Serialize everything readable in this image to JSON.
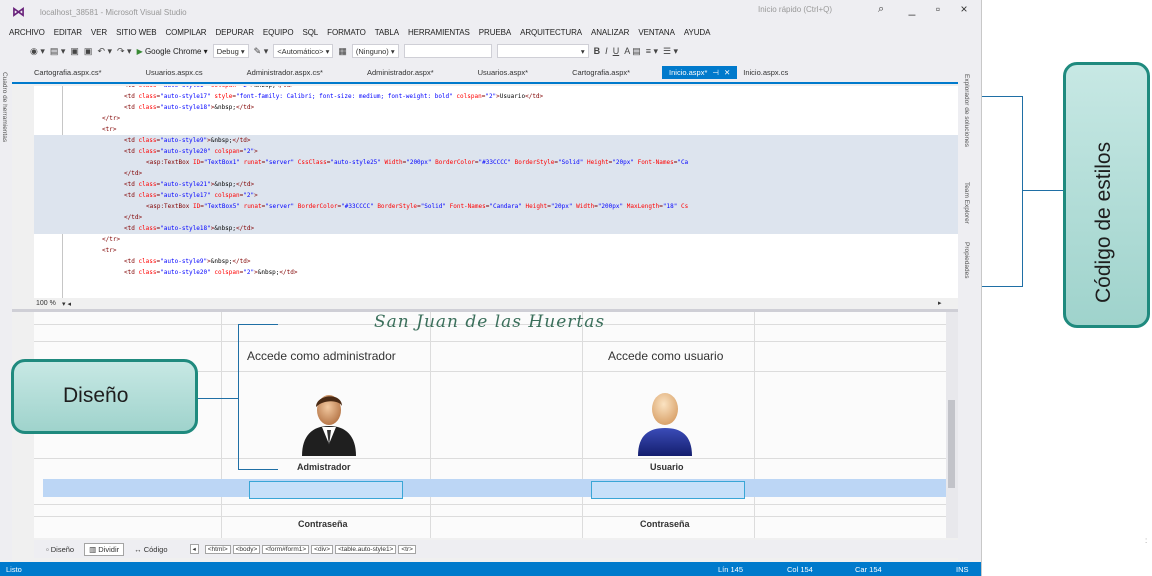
{
  "window": {
    "title": "localhost_38581 - Microsoft Visual Studio",
    "quick_launch_placeholder": "Inicio rápido (Ctrl+Q)",
    "logo_icon": "visual-studio-logo",
    "controls": [
      "_",
      "▫",
      "×"
    ]
  },
  "menu": [
    "ARCHIVO",
    "EDITAR",
    "VER",
    "SITIO WEB",
    "COMPILAR",
    "DEPURAR",
    "EQUIPO",
    "SQL",
    "FORMATO",
    "TABLA",
    "HERRAMIENTAS",
    "PRUEBA",
    "ARQUITECTURA",
    "ANALIZAR",
    "VENTANA",
    "AYUDA"
  ],
  "toolbar": {
    "run_target": "Google Chrome",
    "configuration": "Debug",
    "font_size": "<Automático>",
    "style_combo": "(Ninguno)",
    "format_buttons": [
      "B",
      "I",
      "U"
    ]
  },
  "left_panel_label": "Cuadro de herramientas",
  "doc_tabs": [
    "Cartografia.aspx.cs*",
    "Usuarios.aspx.cs",
    "Administrador.aspx.cs*",
    "Administrador.aspx*",
    "Usuarios.aspx*",
    "Cartografia.aspx*"
  ],
  "active_tab": "Inicio.aspx*",
  "after_tab": "Inicio.aspx.cs",
  "code_lines": [
    {
      "indent": 4,
      "hl": false,
      "parts": [
        [
          "t",
          "<td "
        ],
        [
          "a",
          "class"
        ],
        [
          "t",
          "="
        ],
        [
          "v",
          "\"auto-style1\""
        ],
        [
          "t",
          " "
        ],
        [
          "a",
          "colspan"
        ],
        [
          "t",
          "="
        ],
        [
          "v",
          "\"2\""
        ],
        [
          "t",
          ">"
        ],
        [
          "x",
          "&nbsp;"
        ],
        [
          "t",
          "</td>"
        ]
      ]
    },
    {
      "indent": 4,
      "hl": false,
      "parts": [
        [
          "t",
          "<td "
        ],
        [
          "a",
          "class"
        ],
        [
          "t",
          "="
        ],
        [
          "v",
          "\"auto-style17\""
        ],
        [
          "t",
          " "
        ],
        [
          "a",
          "style"
        ],
        [
          "t",
          "="
        ],
        [
          "v",
          "\"font-family: Calibri; font-size: medium; font-weight: bold\""
        ],
        [
          "t",
          " "
        ],
        [
          "a",
          "colspan"
        ],
        [
          "t",
          "="
        ],
        [
          "v",
          "\"2\""
        ],
        [
          "t",
          ">"
        ],
        [
          "x",
          "Usuario"
        ],
        [
          "t",
          "</td>"
        ]
      ]
    },
    {
      "indent": 4,
      "hl": false,
      "parts": [
        [
          "t",
          "<td "
        ],
        [
          "a",
          "class"
        ],
        [
          "t",
          "="
        ],
        [
          "v",
          "\"auto-style18\""
        ],
        [
          "t",
          ">"
        ],
        [
          "x",
          "&nbsp;"
        ],
        [
          "t",
          "</td>"
        ]
      ]
    },
    {
      "indent": 2,
      "hl": false,
      "parts": [
        [
          "t",
          "</tr>"
        ]
      ]
    },
    {
      "indent": 2,
      "hl": false,
      "parts": [
        [
          "t",
          "<tr>"
        ]
      ]
    },
    {
      "indent": 4,
      "hl": true,
      "parts": [
        [
          "t",
          "<td "
        ],
        [
          "a",
          "class"
        ],
        [
          "t",
          "="
        ],
        [
          "v",
          "\"auto-style9\""
        ],
        [
          "t",
          ">"
        ],
        [
          "x",
          "&nbsp;"
        ],
        [
          "t",
          "</td>"
        ]
      ]
    },
    {
      "indent": 4,
      "hl": true,
      "parts": [
        [
          "t",
          "<td "
        ],
        [
          "a",
          "class"
        ],
        [
          "t",
          "="
        ],
        [
          "v",
          "\"auto-style20\""
        ],
        [
          "t",
          " "
        ],
        [
          "a",
          "colspan"
        ],
        [
          "t",
          "="
        ],
        [
          "v",
          "\"2\""
        ],
        [
          "t",
          ">"
        ]
      ]
    },
    {
      "indent": 6,
      "hl": true,
      "parts": [
        [
          "t",
          "<asp:TextBox "
        ],
        [
          "a",
          "ID"
        ],
        [
          "t",
          "="
        ],
        [
          "v",
          "\"TextBox1\""
        ],
        [
          "t",
          " "
        ],
        [
          "a",
          "runat"
        ],
        [
          "t",
          "="
        ],
        [
          "v",
          "\"server\""
        ],
        [
          "t",
          " "
        ],
        [
          "a",
          "CssClass"
        ],
        [
          "t",
          "="
        ],
        [
          "v",
          "\"auto-style25\""
        ],
        [
          "t",
          " "
        ],
        [
          "a",
          "Width"
        ],
        [
          "t",
          "="
        ],
        [
          "v",
          "\"200px\""
        ],
        [
          "t",
          " "
        ],
        [
          "a",
          "BorderColor"
        ],
        [
          "t",
          "="
        ],
        [
          "v",
          "\"#33CCCC\""
        ],
        [
          "t",
          " "
        ],
        [
          "a",
          "BorderStyle"
        ],
        [
          "t",
          "="
        ],
        [
          "v",
          "\"Solid\""
        ],
        [
          "t",
          " "
        ],
        [
          "a",
          "Height"
        ],
        [
          "t",
          "="
        ],
        [
          "v",
          "\"20px\""
        ],
        [
          "t",
          " "
        ],
        [
          "a",
          "Font-Names"
        ],
        [
          "t",
          "="
        ],
        [
          "v",
          "\"Ca"
        ]
      ]
    },
    {
      "indent": 4,
      "hl": true,
      "parts": [
        [
          "t",
          "</td>"
        ]
      ]
    },
    {
      "indent": 4,
      "hl": true,
      "parts": [
        [
          "t",
          "<td "
        ],
        [
          "a",
          "class"
        ],
        [
          "t",
          "="
        ],
        [
          "v",
          "\"auto-style21\""
        ],
        [
          "t",
          ">"
        ],
        [
          "x",
          "&nbsp;"
        ],
        [
          "t",
          "</td>"
        ]
      ]
    },
    {
      "indent": 4,
      "hl": true,
      "parts": [
        [
          "t",
          "<td "
        ],
        [
          "a",
          "class"
        ],
        [
          "t",
          "="
        ],
        [
          "v",
          "\"auto-style17\""
        ],
        [
          "t",
          " "
        ],
        [
          "a",
          "colspan"
        ],
        [
          "t",
          "="
        ],
        [
          "v",
          "\"2\""
        ],
        [
          "t",
          ">"
        ]
      ]
    },
    {
      "indent": 6,
      "hl": true,
      "parts": [
        [
          "t",
          "<asp:TextBox "
        ],
        [
          "a",
          "ID"
        ],
        [
          "t",
          "="
        ],
        [
          "v",
          "\"TextBox5\""
        ],
        [
          "t",
          " "
        ],
        [
          "a",
          "runat"
        ],
        [
          "t",
          "="
        ],
        [
          "v",
          "\"server\""
        ],
        [
          "t",
          " "
        ],
        [
          "a",
          "BorderColor"
        ],
        [
          "t",
          "="
        ],
        [
          "v",
          "\"#33CCCC\""
        ],
        [
          "t",
          " "
        ],
        [
          "a",
          "BorderStyle"
        ],
        [
          "t",
          "="
        ],
        [
          "v",
          "\"Solid\""
        ],
        [
          "t",
          " "
        ],
        [
          "a",
          "Font-Names"
        ],
        [
          "t",
          "="
        ],
        [
          "v",
          "\"Candara\""
        ],
        [
          "t",
          " "
        ],
        [
          "a",
          "Height"
        ],
        [
          "t",
          "="
        ],
        [
          "v",
          "\"20px\""
        ],
        [
          "t",
          " "
        ],
        [
          "a",
          "Width"
        ],
        [
          "t",
          "="
        ],
        [
          "v",
          "\"200px\""
        ],
        [
          "t",
          " "
        ],
        [
          "a",
          "MaxLength"
        ],
        [
          "t",
          "="
        ],
        [
          "v",
          "\"18\""
        ],
        [
          "t",
          " "
        ],
        [
          "a",
          "Cs"
        ]
      ]
    },
    {
      "indent": 4,
      "hl": true,
      "parts": [
        [
          "t",
          "</td>"
        ]
      ]
    },
    {
      "indent": 4,
      "hl": true,
      "parts": [
        [
          "t",
          "<td "
        ],
        [
          "a",
          "class"
        ],
        [
          "t",
          "="
        ],
        [
          "v",
          "\"auto-style18\""
        ],
        [
          "t",
          ">"
        ],
        [
          "x",
          "&nbsp;"
        ],
        [
          "t",
          "</td>"
        ]
      ]
    },
    {
      "indent": 2,
      "hl": false,
      "parts": [
        [
          "t",
          "</tr>"
        ]
      ]
    },
    {
      "indent": 2,
      "hl": false,
      "parts": [
        [
          "t",
          "<tr>"
        ]
      ]
    },
    {
      "indent": 4,
      "hl": false,
      "parts": [
        [
          "t",
          "<td "
        ],
        [
          "a",
          "class"
        ],
        [
          "t",
          "="
        ],
        [
          "v",
          "\"auto-style9\""
        ],
        [
          "t",
          ">"
        ],
        [
          "x",
          "&nbsp;"
        ],
        [
          "t",
          "</td>"
        ]
      ]
    },
    {
      "indent": 4,
      "hl": false,
      "parts": [
        [
          "t",
          "<td "
        ],
        [
          "a",
          "class"
        ],
        [
          "t",
          "="
        ],
        [
          "v",
          "\"auto-style20\""
        ],
        [
          "t",
          " "
        ],
        [
          "a",
          "colspan"
        ],
        [
          "t",
          "="
        ],
        [
          "v",
          "\"2\""
        ],
        [
          "t",
          ">"
        ],
        [
          "x",
          "&nbsp;"
        ],
        [
          "t",
          "</td>"
        ]
      ]
    }
  ],
  "zoom": "100 %",
  "right_tabs": [
    "Explorador de soluciones",
    "Team Explorer",
    "Propiedades"
  ],
  "design": {
    "site_title": "San Juan de las Huertas",
    "admin_access": "Accede como administrador",
    "user_access": "Accede como usuario",
    "admin_name": "Admistrador",
    "user_name": "Usuario",
    "admin_password": "Contraseña",
    "user_password": "Contraseña"
  },
  "views": {
    "design": "Diseño",
    "split": "Dividir",
    "code": "Código"
  },
  "breadcrumbs": [
    "<html>",
    "<body>",
    "<form#form1>",
    "<div>",
    "<table.auto-style1>",
    "<tr>"
  ],
  "status": {
    "ready": "Listo",
    "line": "Lín 145",
    "col": "Col 154",
    "char": "Car 154",
    "mode": "INS"
  },
  "annotations": {
    "styles": "Código de estilos",
    "design": "Diseño"
  },
  "colors": {
    "accent": "#007acc",
    "callout_border": "#1f8a7e",
    "callout_fill": "#b4ddd8",
    "bracket": "#1f6fa5"
  }
}
